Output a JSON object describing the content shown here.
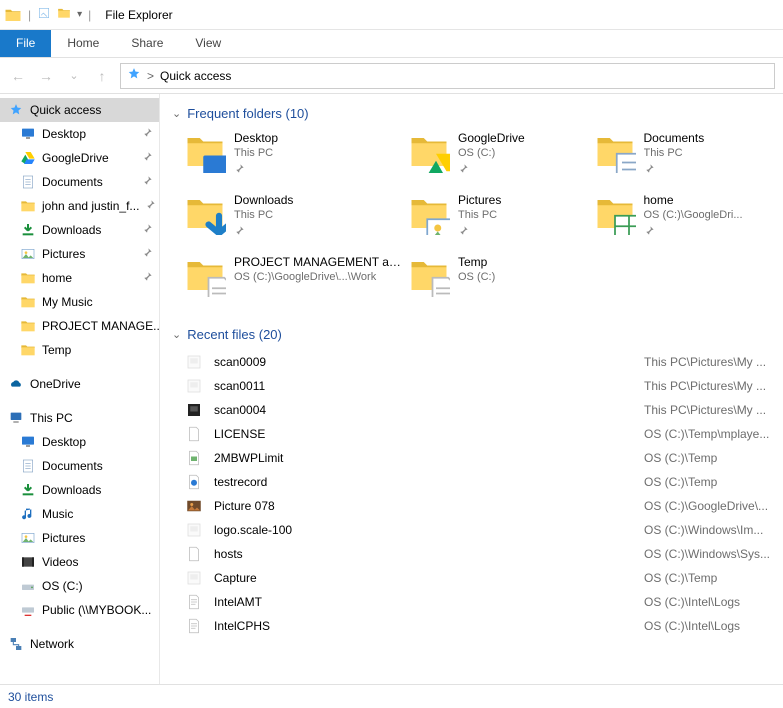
{
  "window": {
    "title": "File Explorer"
  },
  "ribbon": {
    "file": "File",
    "home": "Home",
    "share": "Share",
    "view": "View"
  },
  "breadcrumb": {
    "label": "Quick access",
    "sep": ">"
  },
  "sidebar": {
    "quick_access": {
      "label": "Quick access"
    },
    "quick_items": [
      {
        "label": "Desktop",
        "pinned": true,
        "icon": "desktop"
      },
      {
        "label": "GoogleDrive",
        "pinned": true,
        "icon": "gdrive"
      },
      {
        "label": "Documents",
        "pinned": true,
        "icon": "documents"
      },
      {
        "label": "john and justin_f...",
        "pinned": true,
        "icon": "folder"
      },
      {
        "label": "Downloads",
        "pinned": true,
        "icon": "downloads"
      },
      {
        "label": "Pictures",
        "pinned": true,
        "icon": "pictures"
      },
      {
        "label": "home",
        "pinned": true,
        "icon": "folder"
      },
      {
        "label": "My Music",
        "pinned": false,
        "icon": "folder"
      },
      {
        "label": "PROJECT MANAGE...",
        "pinned": false,
        "icon": "folder"
      },
      {
        "label": "Temp",
        "pinned": false,
        "icon": "folder"
      }
    ],
    "onedrive": {
      "label": "OneDrive"
    },
    "thispc": {
      "label": "This PC"
    },
    "thispc_items": [
      {
        "label": "Desktop",
        "icon": "desktop"
      },
      {
        "label": "Documents",
        "icon": "documents"
      },
      {
        "label": "Downloads",
        "icon": "downloads"
      },
      {
        "label": "Music",
        "icon": "music"
      },
      {
        "label": "Pictures",
        "icon": "pictures"
      },
      {
        "label": "Videos",
        "icon": "videos"
      },
      {
        "label": "OS (C:)",
        "icon": "drive"
      },
      {
        "label": "Public (\\\\MYBOOK...",
        "icon": "netdrive"
      }
    ],
    "network": {
      "label": "Network"
    }
  },
  "groups": {
    "frequent": {
      "header": "Frequent folders (10)"
    },
    "recent": {
      "header": "Recent files (20)"
    }
  },
  "frequent_folders": [
    {
      "name": "Desktop",
      "location": "This PC",
      "pin": true,
      "overlay": "desktop"
    },
    {
      "name": "GoogleDrive",
      "location": "OS (C:)",
      "pin": true,
      "overlay": "gdrive"
    },
    {
      "name": "Documents",
      "location": "This PC",
      "pin": true,
      "overlay": "documents"
    },
    {
      "name": "Downloads",
      "location": "This PC",
      "pin": true,
      "overlay": "downloads"
    },
    {
      "name": "Pictures",
      "location": "This PC",
      "pin": true,
      "overlay": "pictures"
    },
    {
      "name": "home",
      "location": "OS (C:)\\GoogleDri...",
      "pin": true,
      "overlay": "spreadsheet"
    },
    {
      "name": "PROJECT MANAGEMENT an...",
      "location": "OS (C:)\\GoogleDrive\\...\\Work",
      "pin": false,
      "overlay": "files"
    },
    {
      "name": "Temp",
      "location": "OS (C:)",
      "pin": false,
      "overlay": "files"
    }
  ],
  "recent_files": [
    {
      "name": "scan0009",
      "location": "This PC\\Pictures\\My ...",
      "icon": "image-light"
    },
    {
      "name": "scan0011",
      "location": "This PC\\Pictures\\My ...",
      "icon": "image-light"
    },
    {
      "name": "scan0004",
      "location": "This PC\\Pictures\\My ...",
      "icon": "image-dark"
    },
    {
      "name": "LICENSE",
      "location": "OS (C:)\\Temp\\mplaye...",
      "icon": "blank"
    },
    {
      "name": "2MBWPLimit",
      "location": "OS (C:)\\Temp",
      "icon": "reg"
    },
    {
      "name": "testrecord",
      "location": "OS (C:)\\Temp",
      "icon": "audio"
    },
    {
      "name": "Picture 078",
      "location": "OS (C:)\\GoogleDrive\\...",
      "icon": "photo"
    },
    {
      "name": "logo.scale-100",
      "location": "OS (C:)\\Windows\\Im...",
      "icon": "image-light"
    },
    {
      "name": "hosts",
      "location": "OS (C:)\\Windows\\Sys...",
      "icon": "blank"
    },
    {
      "name": "Capture",
      "location": "OS (C:)\\Temp",
      "icon": "image-light"
    },
    {
      "name": "IntelAMT",
      "location": "OS (C:)\\Intel\\Logs",
      "icon": "text"
    },
    {
      "name": "IntelCPHS",
      "location": "OS (C:)\\Intel\\Logs",
      "icon": "text"
    }
  ],
  "status": {
    "items": "30 items"
  }
}
